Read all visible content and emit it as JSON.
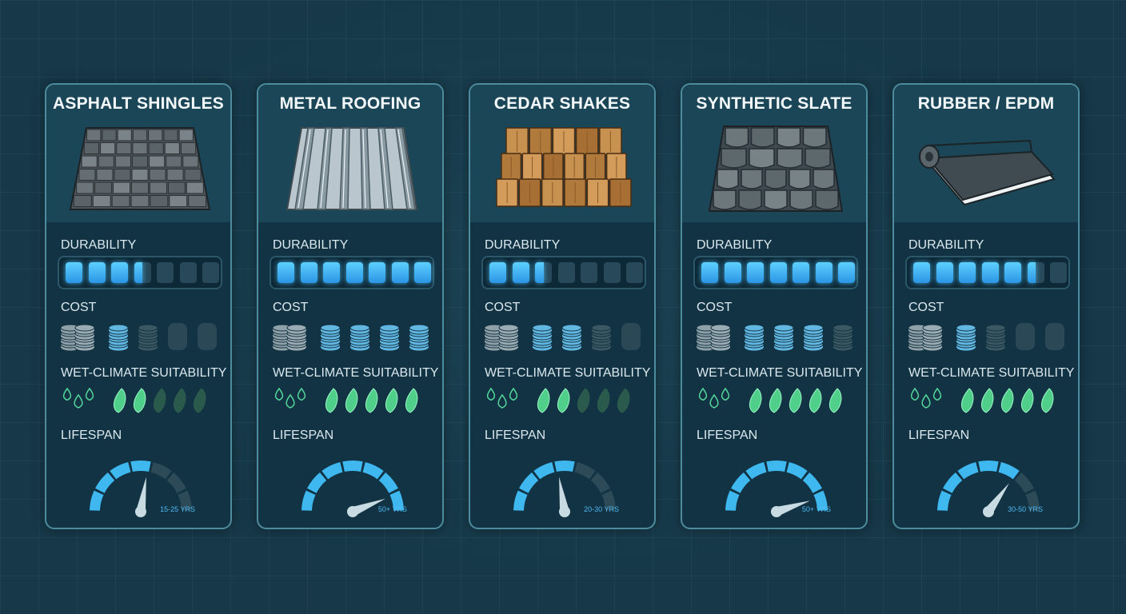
{
  "labels": {
    "durability": "DURABILITY",
    "cost": "COST",
    "wet": "WET-CLIMATE SUITABILITY",
    "lifespan": "LIFESPAN"
  },
  "colors": {
    "durability_on": "#3fb4f5",
    "durability_off": "#28495a",
    "cost_on": "#62b7e2",
    "cost_off": "#3a5864",
    "wet_on": "#4fcf8a",
    "wet_off": "#2a5a4c",
    "gauge_on": "#3fb8f0",
    "gauge_off": "#2d4a58"
  },
  "materials": [
    {
      "title": "ASPHALT SHINGLES",
      "illustration": "asphalt-shingles",
      "durability": 3.5,
      "durability_max": 7,
      "cost": 1,
      "cost_max": 4,
      "wet": 2,
      "wet_max": 5,
      "lifespan_fraction": 0.55,
      "lifespan_label": "15-25 YRS"
    },
    {
      "title": "METAL ROOFING",
      "illustration": "metal-roofing",
      "durability": 7,
      "durability_max": 7,
      "cost": 4,
      "cost_max": 4,
      "wet": 5,
      "wet_max": 5,
      "lifespan_fraction": 0.88,
      "lifespan_label": "50+ YRS"
    },
    {
      "title": "CEDAR SHAKES",
      "illustration": "cedar-shakes",
      "durability": 2.5,
      "durability_max": 7,
      "cost": 2,
      "cost_max": 4,
      "wet": 2,
      "wet_max": 5,
      "lifespan_fraction": 0.45,
      "lifespan_label": "20-30 YRS"
    },
    {
      "title": "SYNTHETIC SLATE",
      "illustration": "synthetic-slate",
      "durability": 7,
      "durability_max": 7,
      "cost": 3,
      "cost_max": 4,
      "wet": 5,
      "wet_max": 5,
      "lifespan_fraction": 0.9,
      "lifespan_label": "50+ YRS"
    },
    {
      "title": "RUBBER / EPDM",
      "illustration": "rubber-epdm-roll",
      "durability": 5.5,
      "durability_max": 7,
      "cost": 1,
      "cost_max": 4,
      "wet": 5,
      "wet_max": 5,
      "lifespan_fraction": 0.7,
      "lifespan_label": "30-50 YRS"
    }
  ]
}
